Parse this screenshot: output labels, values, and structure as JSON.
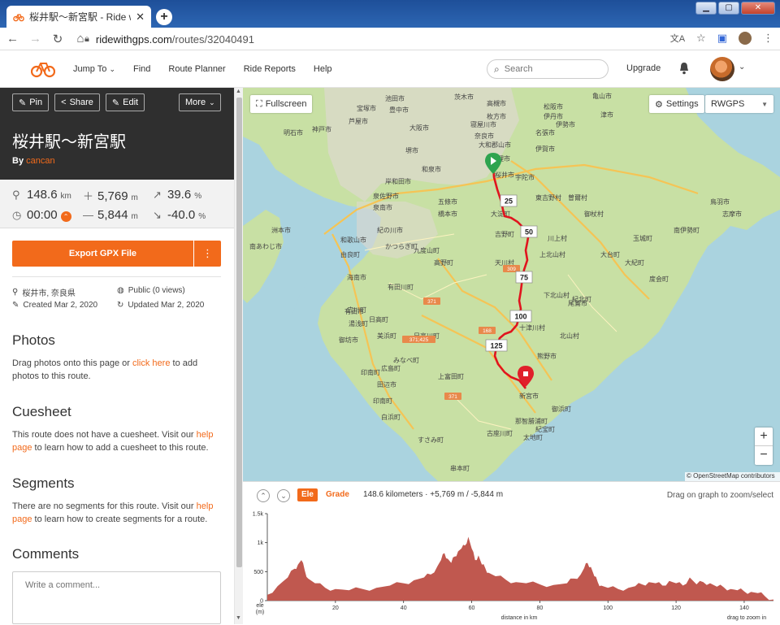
{
  "browser": {
    "tab_title": "桜井駅〜新宮駅 - Ride with GPS",
    "url_host": "ridewithgps.com",
    "url_path": "/routes/32040491"
  },
  "nav": {
    "jump_to": "Jump To",
    "find": "Find",
    "route_planner": "Route Planner",
    "ride_reports": "Ride Reports",
    "help": "Help",
    "search_placeholder": "Search",
    "upgrade": "Upgrade"
  },
  "route": {
    "buttons": {
      "pin": "Pin",
      "share": "Share",
      "edit": "Edit",
      "more": "More"
    },
    "title": "桜井駅〜新宮駅",
    "by_label": "By",
    "author": "cancan",
    "distance": "148.6",
    "distance_unit": "km",
    "elev_gain": "5,769",
    "elev_gain_unit": "m",
    "max_grade": "39.6",
    "max_grade_unit": "%",
    "time": "00:00",
    "elev_loss": "5,844",
    "elev_loss_unit": "m",
    "min_grade": "-40.0",
    "min_grade_unit": "%",
    "export_label": "Export GPX File",
    "location": "桜井市, 奈良県",
    "visibility": "Public (0 views)",
    "created": "Created Mar 2, 2020",
    "updated": "Updated Mar 2, 2020"
  },
  "sections": {
    "photos_title": "Photos",
    "photos_text_pre": "Drag photos onto this page or ",
    "photos_link": "click here",
    "photos_text_post": " to add photos to this route.",
    "cuesheet_title": "Cuesheet",
    "cuesheet_text_pre": "This route does not have a cuesheet. Visit our ",
    "cuesheet_link": "help page",
    "cuesheet_text_post": " to learn how to add a cuesheet to this route.",
    "segments_title": "Segments",
    "segments_text_pre": "There are no segments for this route. Visit our ",
    "segments_link": "help page",
    "segments_text_post": " to learn how to create segments for a route.",
    "comments_title": "Comments",
    "comment_placeholder": "Write a comment..."
  },
  "map": {
    "fullscreen": "Fullscreen",
    "settings": "Settings",
    "layer": "RWGPS",
    "attribution": "© OpenStreetMap contributors",
    "markers": [
      "25",
      "50",
      "75",
      "100",
      "125"
    ],
    "road_labels": [
      "309",
      "371",
      "168",
      "371;425",
      "371"
    ],
    "places": [
      "池田市",
      "豊中市",
      "茨木市",
      "高槻市",
      "枚方市",
      "寝屋川市",
      "大阪市",
      "堺市",
      "岸和田市",
      "和泉市",
      "泉佐野市",
      "泉南市",
      "和歌山市",
      "海南市",
      "有田市",
      "御坊市",
      "田辺市",
      "白浜町",
      "すさみ町",
      "串本町",
      "那智勝浦町",
      "新宮市",
      "熊野市",
      "尾鷲市",
      "紀北町",
      "大台町",
      "松阪市",
      "伊勢市",
      "鳥羽市",
      "志摩市",
      "名張市",
      "伊賀市",
      "奈良市",
      "大和郡山市",
      "天理市",
      "桜井市",
      "宇陀市",
      "五條市",
      "橋本市",
      "高野町",
      "十津川村",
      "下北山村",
      "洲本市",
      "南あわじ市",
      "明石市",
      "神戸市",
      "芦屋市",
      "宝塚市",
      "亀山市",
      "津市",
      "伊丹市",
      "紀の川市",
      "有田川町",
      "日高川町",
      "みなべ町",
      "印南町",
      "由良町",
      "広川町",
      "湯浅町",
      "かつらぎ町",
      "九度山町",
      "大淀町",
      "吉野町",
      "天川村",
      "上北山村",
      "川上村",
      "東吉野村",
      "曽爾村",
      "御杖村",
      "大紀町",
      "度会町",
      "玉城町",
      "南伊勢町",
      "御浜町",
      "紀宝町",
      "北山村",
      "古座川町",
      "太地町",
      "上富田町",
      "印南町",
      "美浜町",
      "日高町",
      "広島町"
    ]
  },
  "elevation": {
    "ele_label": "Ele",
    "grade_label": "Grade",
    "summary": "148.6 kilometers · +5,769 m / -5,844 m",
    "hint": "Drag on graph to zoom/select",
    "xlabel": "distance in km",
    "ylabel_top": "ele",
    "ylabel_unit": "(m)",
    "zoom_hint": "drag to zoom in"
  },
  "chart_data": {
    "type": "area",
    "title": "",
    "xlabel": "distance in km",
    "ylabel": "ele (m)",
    "xlim": [
      0,
      148.6
    ],
    "ylim": [
      0,
      1500
    ],
    "xticks": [
      20,
      40,
      60,
      80,
      100,
      120,
      140
    ],
    "yticks": [
      0,
      500,
      1000,
      1500
    ],
    "ytick_labels": [
      "0",
      "500",
      "1k",
      "1.5k"
    ],
    "x": [
      0,
      3,
      6,
      8,
      9,
      10,
      11,
      12,
      14,
      17,
      20,
      24,
      28,
      32,
      36,
      40,
      43,
      46,
      48,
      50,
      51,
      52,
      53,
      54,
      55,
      56,
      57,
      58,
      59,
      60,
      61,
      62,
      63,
      64,
      65,
      67,
      70,
      73,
      76,
      80,
      84,
      88,
      90,
      92,
      93,
      94,
      95,
      96,
      97,
      98,
      100,
      103,
      106,
      108,
      110,
      112,
      114,
      116,
      118,
      120,
      122,
      124,
      126,
      128,
      130,
      132,
      134,
      136,
      138,
      140,
      142,
      144,
      146,
      148.6
    ],
    "values": [
      100,
      250,
      400,
      550,
      620,
      700,
      520,
      380,
      300,
      220,
      200,
      180,
      200,
      220,
      260,
      300,
      350,
      400,
      450,
      600,
      700,
      820,
      720,
      650,
      760,
      850,
      900,
      950,
      1100,
      900,
      700,
      780,
      620,
      560,
      480,
      420,
      360,
      320,
      300,
      280,
      270,
      300,
      380,
      450,
      560,
      650,
      580,
      420,
      320,
      260,
      220,
      200,
      220,
      250,
      280,
      320,
      300,
      260,
      340,
      300,
      260,
      400,
      280,
      320,
      300,
      240,
      230,
      200,
      180,
      160,
      150,
      130,
      80,
      20
    ],
    "fill_color": "#c0584f"
  },
  "colors": {
    "accent": "#f26a1b",
    "dark_header": "#2f2f2f",
    "route_line": "#e0141e",
    "land": "#c8e0a4",
    "water": "#aad3df"
  }
}
